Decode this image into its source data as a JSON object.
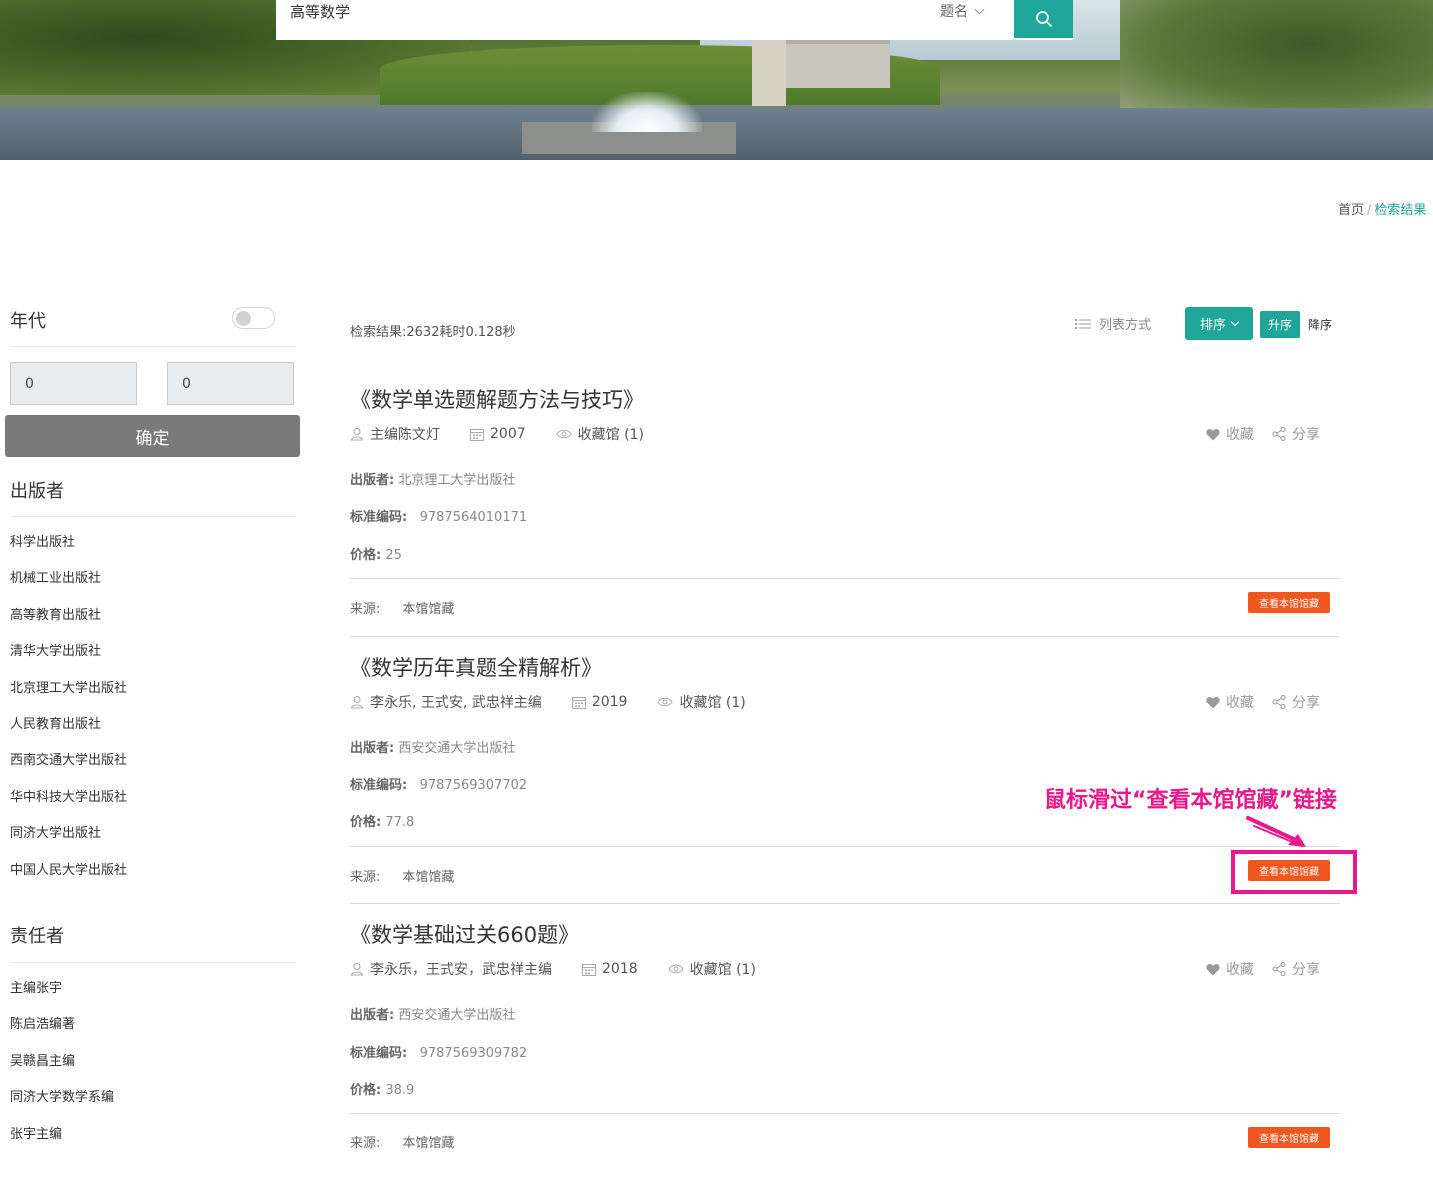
{
  "search": {
    "query": "高等数学",
    "field": "题名"
  },
  "breadcrumb": {
    "home": "首页",
    "separator": "/",
    "current": "检索结果"
  },
  "sidebar": {
    "year": {
      "title": "年代",
      "from": "0",
      "to": "0",
      "confirm": "确定"
    },
    "publisher": {
      "title": "出版者",
      "items": [
        "科学出版社",
        "机械工业出版社",
        "高等教育出版社",
        "清华大学出版社",
        "北京理工大学出版社",
        "人民教育出版社",
        "西南交通大学出版社",
        "华中科技大学出版社",
        "同济大学出版社",
        "中国人民大学出版社"
      ]
    },
    "author": {
      "title": "责任者",
      "items": [
        "主编张宇",
        "陈启浩编著",
        "吴赣昌主编",
        "同济大学数学系编",
        "张宇主编"
      ]
    }
  },
  "toolbar": {
    "results_count": "检索结果:2632耗时0.128秒",
    "list_mode": "列表方式",
    "sort": "排序",
    "asc": "升序",
    "desc": "降序"
  },
  "labels": {
    "publisher": "出版者:",
    "isbn": "标准编码:",
    "price": "价格:",
    "source": "来源:",
    "favorite": "收藏",
    "share": "分享",
    "view_btn": "查看本馆馆藏"
  },
  "results": [
    {
      "title": "《数学单选题解题方法与技巧》",
      "author": "主编陈文灯",
      "year": "2007",
      "holdings": "收藏馆 (1)",
      "publisher": "北京理工大学出版社",
      "isbn": "9787564010171",
      "price": "25",
      "source": "本馆馆藏"
    },
    {
      "title": "《数学历年真题全精解析》",
      "author": "李永乐, 王式安, 武忠祥主编",
      "year": "2019",
      "holdings": "收藏馆 (1)",
      "publisher": "西安交通大学出版社",
      "isbn": "9787569307702",
      "price": "77.8",
      "source": "本馆馆藏"
    },
    {
      "title": "《数学基础过关660题》",
      "author": "李永乐，王式安，武忠祥主编",
      "year": "2018",
      "holdings": "收藏馆 (1)",
      "publisher": "西安交通大学出版社",
      "isbn": "9787569309782",
      "price": "38.9",
      "source": "本馆馆藏"
    }
  ],
  "annotation": {
    "text": "鼠标滑过“查看本馆馆藏”链接",
    "color": "#e8198b"
  },
  "colors": {
    "accent": "#1fa698",
    "view_button": "#f0571f"
  }
}
